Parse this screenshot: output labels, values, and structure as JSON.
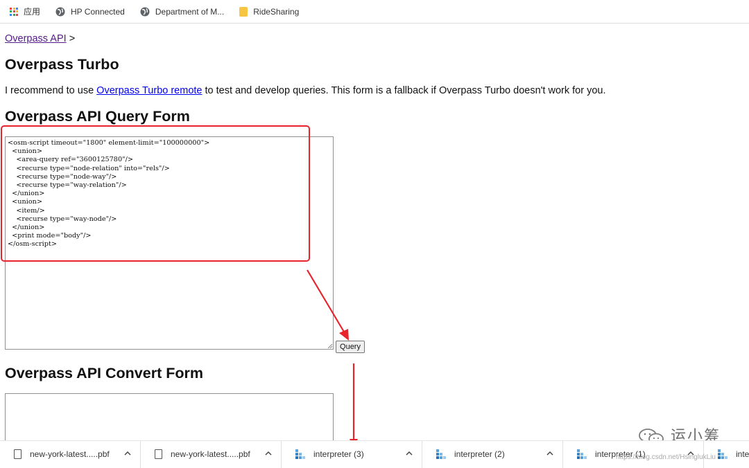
{
  "bookmarks_bar": {
    "items": [
      {
        "label": "应用",
        "icon": "apps-grid-icon"
      },
      {
        "label": "HP Connected",
        "icon": "globe-icon"
      },
      {
        "label": "Department of M...",
        "icon": "globe-icon"
      },
      {
        "label": "RideSharing",
        "icon": "folder-icon"
      }
    ]
  },
  "breadcrumb": {
    "link": "Overpass API",
    "separator": ">"
  },
  "page_title": "Overpass Turbo",
  "intro": {
    "before": "I recommend to use ",
    "link": "Overpass Turbo remote",
    "after": " to test and develop queries. This form is a fallback if Overpass Turbo doesn't work for you."
  },
  "query_form": {
    "title": "Overpass API Query Form",
    "query_text": "<osm-script timeout=\"1800\" element-limit=\"100000000\">\n  <union>\n    <area-query ref=\"3600125780\"/>\n    <recurse type=\"node-relation\" into=\"rels\"/>\n    <recurse type=\"node-way\"/>\n    <recurse type=\"way-relation\"/>\n  </union>\n  <union>\n    <item/>\n    <recurse type=\"way-node\"/>\n  </union>\n  <print mode=\"body\"/>\n</osm-script>",
    "button_label": "Query"
  },
  "convert_form": {
    "title": "Overpass API Convert Form"
  },
  "downloads_bar": {
    "items": [
      {
        "name": "new-york-latest.....pbf",
        "icon": "file-icon"
      },
      {
        "name": "new-york-latest.....pbf",
        "icon": "file-icon"
      },
      {
        "name": "interpreter (3)",
        "icon": "package-icon"
      },
      {
        "name": "interpreter (2)",
        "icon": "package-icon"
      },
      {
        "name": "interpreter (1)",
        "icon": "package-icon"
      },
      {
        "name": "inter",
        "icon": "package-icon"
      }
    ]
  },
  "watermark": {
    "text": "运小筹",
    "url": "https://blog.csdn.net/HsinglukLiu"
  },
  "colors": {
    "annotation_red": "#e8232b",
    "link_blue": "#0000ee",
    "link_visited": "#551a8b"
  }
}
